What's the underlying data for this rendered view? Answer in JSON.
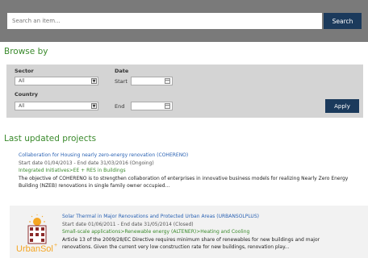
{
  "search": {
    "placeholder": "Search an item...",
    "button_label": "Search"
  },
  "browse": {
    "title": "Browse by",
    "sector_label": "Sector",
    "sector_value": "All",
    "country_label": "Country",
    "country_value": "All",
    "date_label": "Date",
    "start_label": "Start",
    "end_label": "End",
    "apply_label": "Apply"
  },
  "projects": {
    "title": "Last updated projects",
    "items": [
      {
        "title": "Collaboration for Housing nearly zero-energy renovation (COHERENO)",
        "dates": "Start date 01/04/2013 - End date 31/03/2016 (Ongoing)",
        "category": "Integrated Initiatives>EE + RES in Buildings",
        "description_line1": "The objective of COHERENO is to strengthen collaboration of enterprises in innovative business models for realizing Nearly Zero Energy",
        "description_line2": "Building (NZEB) renovations in single family owner occupied..."
      },
      {
        "title": "Solar Thermal in Major Renovations and Protected Urban Areas (URBANSOLPLUS)",
        "dates": "Start date 01/06/2011 - End date 31/05/2014 (Closed)",
        "category": "Small-scale applications>Renewable energy (ALTENER)>Heating and Cooling",
        "description_line1": "Article 13 of the 2009/28/EC Directive requires minimum share of renewables for new buildings and major",
        "description_line2": "renovations. Given the current very low construction rate for new buildings, renovation play...",
        "logo_text": "UrbanSol"
      }
    ]
  },
  "colors": {
    "accent_green": "#3a8a2c",
    "link_blue": "#2a62b3",
    "button_navy": "#1b3a5c"
  }
}
